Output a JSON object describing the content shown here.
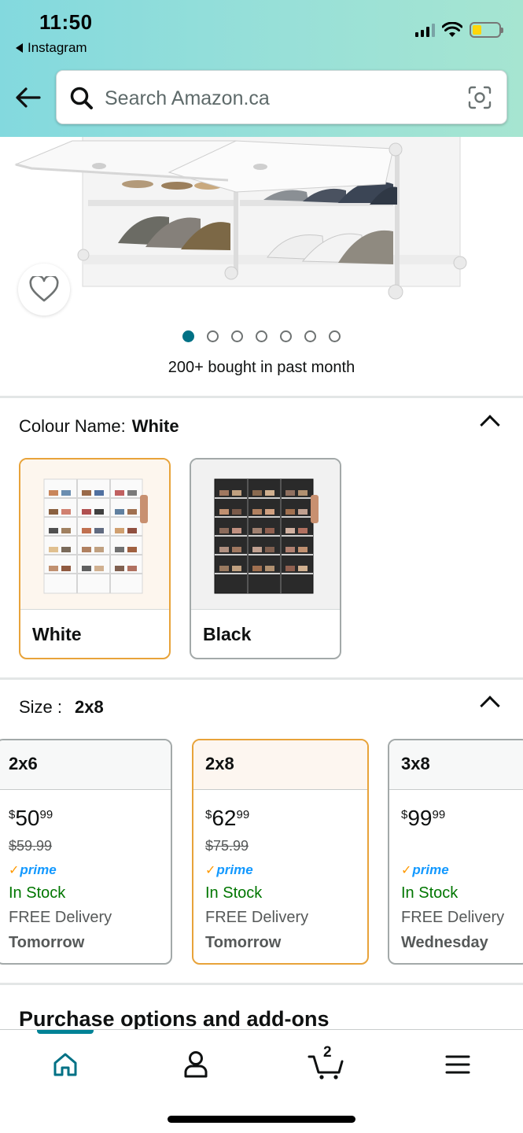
{
  "status_bar": {
    "time": "11:50",
    "back_app": "Instagram"
  },
  "search": {
    "placeholder": "Search Amazon.ca"
  },
  "gallery": {
    "image_count": 7,
    "active_index": 0,
    "bought_text": "200+ bought in past month"
  },
  "colour": {
    "label": "Colour Name:",
    "selected": "White",
    "options": [
      {
        "label": "White",
        "selected": true
      },
      {
        "label": "Black",
        "selected": false
      }
    ]
  },
  "size": {
    "label": "Size :",
    "selected": "2x8",
    "options": [
      {
        "label": "2x6",
        "price_symbol": "$",
        "price_whole": "50",
        "price_cents": "99",
        "was_price": "$59.99",
        "prime": "prime",
        "stock": "In Stock",
        "delivery": "FREE Delivery",
        "day": "Tomorrow",
        "selected": false
      },
      {
        "label": "2x8",
        "price_symbol": "$",
        "price_whole": "62",
        "price_cents": "99",
        "was_price": "$75.99",
        "prime": "prime",
        "stock": "In Stock",
        "delivery": "FREE Delivery",
        "day": "Tomorrow",
        "selected": true
      },
      {
        "label": "3x8",
        "price_symbol": "$",
        "price_whole": "99",
        "price_cents": "99",
        "was_price": "",
        "prime": "prime",
        "stock": "In Stock",
        "delivery": "FREE Delivery",
        "day": "Wednesday",
        "selected": false
      }
    ]
  },
  "purchase_title": "Purchase options and add-ons",
  "bottom_nav": {
    "active": "home",
    "cart_count": "2",
    "items": [
      "home",
      "account",
      "cart",
      "menu"
    ]
  },
  "colors": {
    "header_gradient_start": "#83d9de",
    "header_gradient_end": "#a6e5d1",
    "selected_border": "#e8a33a",
    "in_stock": "#007600",
    "prime_blue": "#1399ff",
    "active_teal": "#007185"
  }
}
